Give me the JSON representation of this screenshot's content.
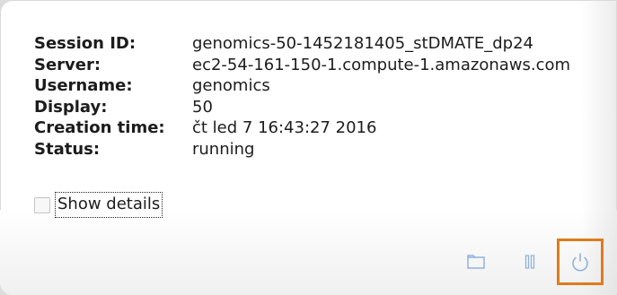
{
  "session_info": {
    "rows": [
      {
        "label": "Session ID:",
        "value": "genomics-50-1452181405_stDMATE_dp24"
      },
      {
        "label": "Server:",
        "value": "ec2-54-161-150-1.compute-1.amazonaws.com"
      },
      {
        "label": "Username:",
        "value": "genomics"
      },
      {
        "label": "Display:",
        "value": "50"
      },
      {
        "label": "Creation time:",
        "value": "čt led 7 16:43:27 2016"
      },
      {
        "label": "Status:",
        "value": "running"
      }
    ]
  },
  "details": {
    "label": "Show details",
    "checked": false
  },
  "toolbar": {
    "buttons": [
      {
        "name": "folder-icon"
      },
      {
        "name": "pause-icon"
      },
      {
        "name": "power-icon"
      }
    ],
    "highlight_color": "#e07b1a",
    "icon_color": "#8fb3d9"
  }
}
